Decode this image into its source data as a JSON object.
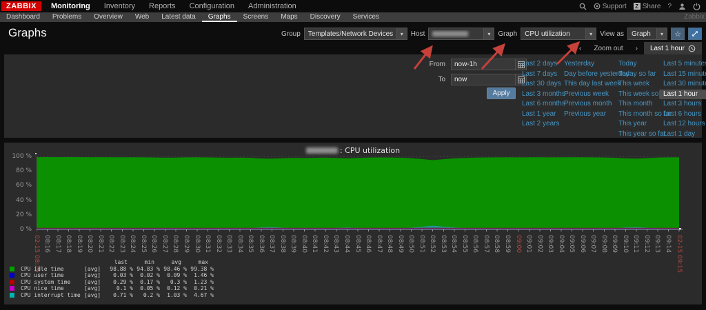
{
  "topbar": {
    "logo": "ZABBIX",
    "menu": [
      {
        "label": "Monitoring",
        "active": true
      },
      {
        "label": "Inventory",
        "active": false
      },
      {
        "label": "Reports",
        "active": false
      },
      {
        "label": "Configuration",
        "active": false
      },
      {
        "label": "Administration",
        "active": false
      }
    ],
    "support_label": "Support",
    "share_label": "Share",
    "share_glyph": "Z",
    "help_label": "?"
  },
  "subnav": {
    "items": [
      "Dashboard",
      "Problems",
      "Overview",
      "Web",
      "Latest data",
      "Graphs",
      "Screens",
      "Maps",
      "Discovery",
      "Services"
    ],
    "active": "Graphs",
    "watermark": "Zabbix"
  },
  "page": {
    "title": "Graphs"
  },
  "filters": {
    "group_label": "Group",
    "group_value": "Templates/Network Devices",
    "host_label": "Host",
    "host_redacted": true,
    "graph_label": "Graph",
    "graph_value": "CPU utilization",
    "view_as_label": "View as",
    "view_as_value": "Graph",
    "favourite_glyph": "☆"
  },
  "timebar": {
    "prev_glyph": "‹",
    "zoom_out_label": "Zoom out",
    "next_glyph": "›",
    "tab_label": "Last 1 hour"
  },
  "timepanel": {
    "from_label": "From",
    "from_value": "now-1h",
    "to_label": "To",
    "to_value": "now",
    "apply_label": "Apply",
    "selected": "Last 1 hour",
    "columns": [
      [
        "Last 2 days",
        "Last 7 days",
        "Last 30 days",
        "Last 3 months",
        "Last 6 months",
        "Last 1 year",
        "Last 2 years"
      ],
      [
        "Yesterday",
        "Day before yesterday",
        "This day last week",
        "Previous week",
        "Previous month",
        "Previous year"
      ],
      [
        "Today",
        "Today so far",
        "This week",
        "This week so far",
        "This month",
        "This month so far",
        "This year",
        "This year so far"
      ],
      [
        "Last 5 minutes",
        "Last 15 minutes",
        "Last 30 minutes",
        "Last 1 hour",
        "Last 3 hours",
        "Last 6 hours",
        "Last 12 hours",
        "Last 1 day"
      ]
    ]
  },
  "chart_data": {
    "type": "area",
    "host_redacted": true,
    "title_suffix": ": CPU utilization",
    "ylim": [
      0,
      100
    ],
    "grid": "dashed",
    "y_ticks": [
      "100 %",
      "80 %",
      "60 %",
      "40 %",
      "20 %",
      "0 %"
    ],
    "x_labels": [
      "02-15 08:15",
      "08:16",
      "08:17",
      "08:18",
      "08:19",
      "08:20",
      "08:21",
      "08:22",
      "08:23",
      "08:24",
      "08:25",
      "08:26",
      "08:27",
      "08:28",
      "08:29",
      "08:30",
      "08:31",
      "08:32",
      "08:33",
      "08:34",
      "08:35",
      "08:36",
      "08:37",
      "08:38",
      "08:39",
      "08:40",
      "08:41",
      "08:42",
      "08:43",
      "08:44",
      "08:45",
      "08:46",
      "08:47",
      "08:48",
      "08:49",
      "08:50",
      "08:51",
      "08:52",
      "08:53",
      "08:54",
      "08:55",
      "08:56",
      "08:57",
      "08:58",
      "08:59",
      "09:00",
      "09:01",
      "09:02",
      "09:03",
      "09:04",
      "09:05",
      "09:06",
      "09:07",
      "09:08",
      "09:09",
      "09:10",
      "09:11",
      "09:12",
      "09:13",
      "09:14",
      "02-15 09:15"
    ],
    "x_red_indices": [
      0,
      45,
      60
    ],
    "series": [
      {
        "name": "CPU idle time",
        "color": "#0A9000",
        "values": [
          99.0,
          99.1,
          99.0,
          99.1,
          99.0,
          98.9,
          99.0,
          98.9,
          98.8,
          98.9,
          98.7,
          98.5,
          98.2,
          98.4,
          98.7,
          98.8,
          98.6,
          98.4,
          98.1,
          98.3,
          98.0,
          97.1,
          96.9,
          97.5,
          98.0,
          97.7,
          98.1,
          98.4,
          97.9,
          97.3,
          97.8,
          98.3,
          98.6,
          98.5,
          98.2,
          97.5,
          96.3,
          94.83,
          96.1,
          97.3,
          97.9,
          98.3,
          98.6,
          98.7,
          98.8,
          98.7,
          98.8,
          98.9,
          98.7,
          98.8,
          98.9,
          98.8,
          98.7,
          98.5,
          98.1,
          97.3,
          96.9,
          97.6,
          98.4,
          98.7,
          98.8
        ]
      },
      {
        "name": "CPU interrupt time",
        "color": "#1E8C8C",
        "values": [
          0.5,
          0.4,
          0.5,
          0.4,
          0.5,
          0.6,
          0.5,
          0.6,
          0.7,
          0.6,
          0.8,
          1.0,
          1.3,
          1.1,
          0.8,
          0.7,
          0.9,
          1.1,
          1.4,
          1.2,
          1.5,
          2.4,
          2.6,
          2.0,
          1.5,
          1.8,
          1.4,
          1.1,
          1.6,
          2.2,
          1.7,
          1.2,
          0.9,
          1.0,
          1.3,
          2.0,
          3.2,
          4.67,
          3.4,
          2.2,
          1.6,
          1.2,
          0.9,
          0.8,
          0.7,
          0.8,
          0.7,
          0.6,
          0.8,
          0.7,
          0.6,
          0.7,
          0.8,
          1.0,
          1.4,
          2.2,
          2.6,
          1.9,
          1.1,
          0.8,
          0.7
        ]
      },
      {
        "name": "CPU user time",
        "color": "#2222CC",
        "values": null
      },
      {
        "name": "CPU system time",
        "color": "#8C1414",
        "values": null
      }
    ]
  },
  "legend": {
    "headers": [
      "last",
      "min",
      "avg",
      "max"
    ],
    "rows": [
      {
        "name": "CPU idle time",
        "func": "[avg]",
        "color": "#00A000",
        "values": [
          "98.88 %",
          "94.83 %",
          "98.46 %",
          "99.38 %"
        ]
      },
      {
        "name": "CPU user time",
        "func": "[avg]",
        "color": "#0000C8",
        "values": [
          "0.03 %",
          "0.02 %",
          "0.09 %",
          "1.46 %"
        ]
      },
      {
        "name": "CPU system time",
        "func": "[avg]",
        "color": "#B40000",
        "values": [
          "0.29 %",
          "0.17 %",
          "0.3 %",
          "1.23 %"
        ]
      },
      {
        "name": "CPU nice time",
        "func": "[avg]",
        "color": "#C800C8",
        "values": [
          "0.1 %",
          "0.05 %",
          "0.12 %",
          "0.21 %"
        ]
      },
      {
        "name": "CPU interrupt time",
        "func": "[avg]",
        "color": "#00B4B4",
        "values": [
          "0.71 %",
          "0.2 %",
          "1.03 %",
          "4.67 %"
        ]
      }
    ]
  },
  "annotation": {
    "arrow_color": "#c5413a"
  }
}
